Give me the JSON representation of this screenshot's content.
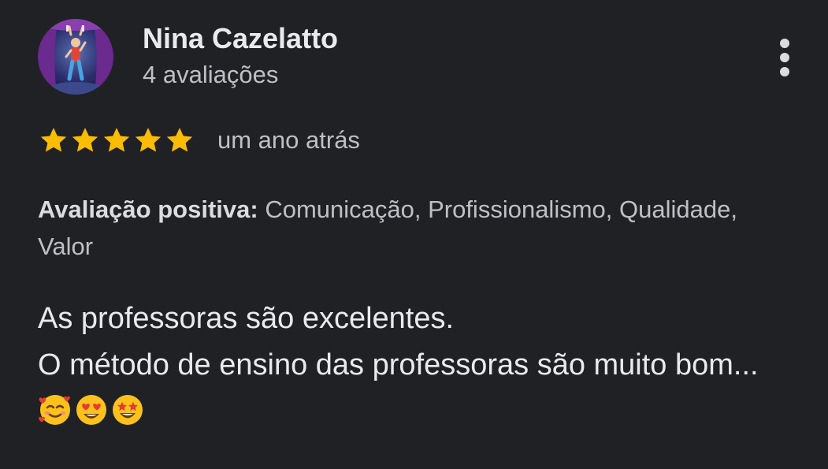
{
  "reviewer": {
    "name": "Nina Cazelatto",
    "review_count": "4 avaliações",
    "avatar_icon": "performer-on-stage-avatar"
  },
  "menu": {
    "icon": "more-vertical-icon"
  },
  "rating": {
    "stars": 5,
    "max_stars": 5,
    "star_color": "#fbbc04",
    "date": "um ano atrás"
  },
  "attributes": {
    "label": "Avaliação positiva:",
    "values": "Comunicação, Profissionalismo, Qualidade, Valor"
  },
  "review": {
    "line1": "As professoras são excelentes.",
    "line2": "O método de ensino das professoras são muito bom...",
    "emojis": [
      "smiling-face-with-hearts-emoji",
      "heart-eyes-emoji",
      "star-struck-emoji"
    ]
  },
  "colors": {
    "background": "#202124",
    "primary_text": "#e8eaed",
    "secondary_text": "#bdc1c6"
  }
}
